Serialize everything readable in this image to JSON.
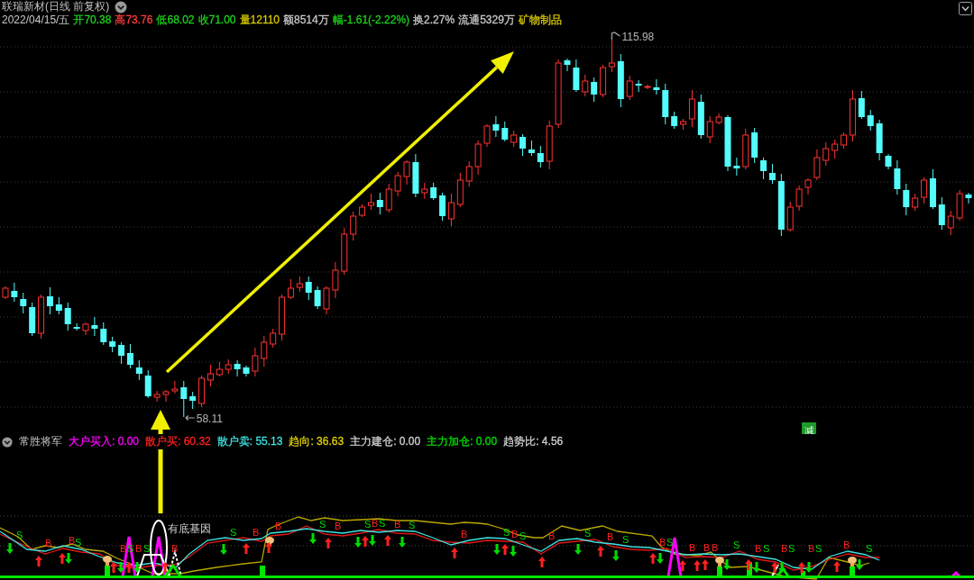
{
  "header": {
    "title": "联瑞新材(日线 前复权)",
    "date": "2022/04/15/五",
    "stats": [
      {
        "text": "开70.38",
        "color": "#1ed21e"
      },
      {
        "text": "高73.76",
        "color": "#ff3c3c"
      },
      {
        "text": "低68.02",
        "color": "#1ed21e"
      },
      {
        "text": "收71.00",
        "color": "#1ed21e"
      },
      {
        "text": "量12110",
        "color": "#d6c800"
      },
      {
        "text": "额8514万",
        "color": "#c8c8c8"
      },
      {
        "text": "幅-1.61(-2.22%)",
        "color": "#1ed21e"
      },
      {
        "text": "换2.27%",
        "color": "#c8c8c8"
      },
      {
        "text": "流通5329万",
        "color": "#c8c8c8"
      },
      {
        "text": "矿物制品",
        "color": "#d6c800"
      }
    ]
  },
  "price_chart": {
    "high_label": "115.98",
    "low_label": "58.11",
    "badge": "减"
  },
  "indicator": {
    "name": "常胜将军",
    "items": [
      {
        "text": "大户买入: 0.00",
        "color": "#ff00ff"
      },
      {
        "text": "散户买: 60.32",
        "color": "#ff2020"
      },
      {
        "text": "散户卖: 55.13",
        "color": "#40e0e0"
      },
      {
        "text": "趋向: 36.63",
        "color": "#e0d000"
      },
      {
        "text": "主力建仓: 0.00",
        "color": "#d0d0d0"
      },
      {
        "text": "主力加仓: 0.00",
        "color": "#00e000"
      },
      {
        "text": "趋势比: 4.56",
        "color": "#d0d0d0"
      }
    ],
    "annotation": "有底基因",
    "signals": [
      {
        "kind": "sell",
        "label": "S"
      },
      {
        "kind": "buy",
        "label": "B"
      },
      {
        "kind": "buy",
        "label": "B"
      },
      {
        "kind": "sell",
        "label": "S"
      },
      {
        "kind": "buy",
        "label": "B"
      },
      {
        "kind": "sell",
        "label": "S"
      },
      {
        "kind": "buy",
        "label": "B"
      },
      {
        "kind": "sell",
        "label": "S"
      },
      {
        "kind": "buy",
        "label": "B"
      },
      {
        "kind": "sell",
        "label": "S"
      },
      {
        "kind": "buy",
        "label": "B"
      },
      {
        "kind": "buy",
        "label": "B"
      },
      {
        "kind": "sell",
        "label": "S"
      },
      {
        "kind": "buy",
        "label": "B"
      },
      {
        "kind": "sell",
        "label": "S"
      },
      {
        "kind": "buy",
        "label": "B"
      },
      {
        "kind": "sell",
        "label": "S"
      },
      {
        "kind": "buy",
        "label": "B"
      },
      {
        "kind": "sell",
        "label": "S"
      },
      {
        "kind": "buy",
        "label": "B"
      },
      {
        "kind": "sell",
        "label": "S"
      },
      {
        "kind": "buy",
        "label": "B"
      },
      {
        "kind": "sell",
        "label": "S"
      },
      {
        "kind": "buy",
        "label": "B"
      },
      {
        "kind": "sell",
        "label": "S"
      },
      {
        "kind": "buy",
        "label": "B"
      },
      {
        "kind": "sell",
        "label": "S"
      },
      {
        "kind": "buy",
        "label": "B"
      },
      {
        "kind": "sell",
        "label": "S"
      },
      {
        "kind": "buy",
        "label": "B"
      },
      {
        "kind": "buy",
        "label": "B"
      },
      {
        "kind": "buy",
        "label": "B"
      },
      {
        "kind": "sell",
        "label": "S"
      },
      {
        "kind": "buy",
        "label": "B"
      },
      {
        "kind": "sell",
        "label": "S"
      },
      {
        "kind": "buy",
        "label": "B"
      },
      {
        "kind": "sell",
        "label": "S"
      },
      {
        "kind": "buy",
        "label": "B"
      },
      {
        "kind": "sell",
        "label": "S"
      },
      {
        "kind": "buy",
        "label": "B"
      },
      {
        "kind": "sell",
        "label": "S"
      }
    ]
  }
}
